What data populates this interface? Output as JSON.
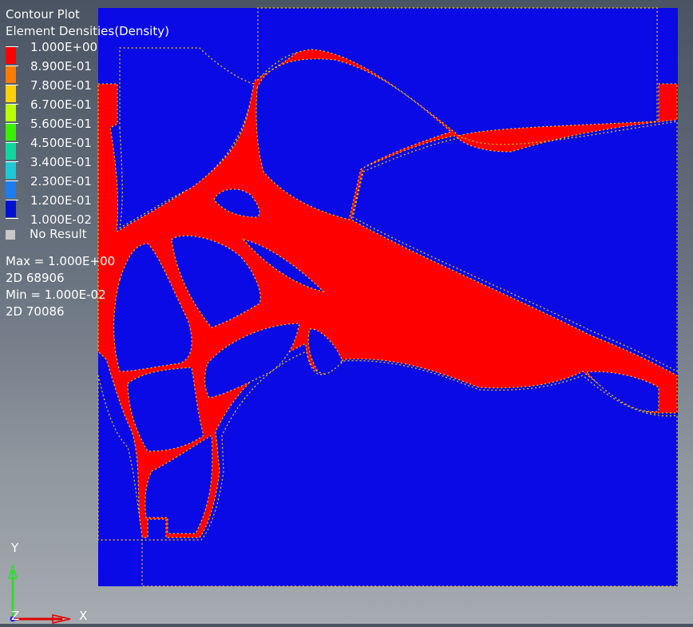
{
  "legend": {
    "title": "Contour Plot",
    "subtitle": "Element Densities(Density)",
    "levels": [
      {
        "label": "1.000E+00",
        "color": "#ff0000"
      },
      {
        "label": "8.900E-01",
        "color": "#ff7b00"
      },
      {
        "label": "7.800E-01",
        "color": "#ffd000"
      },
      {
        "label": "6.700E-01",
        "color": "#b9ff00"
      },
      {
        "label": "5.600E-01",
        "color": "#3bf000"
      },
      {
        "label": "4.500E-01",
        "color": "#11d6a0"
      },
      {
        "label": "3.400E-01",
        "color": "#1ec8d6"
      },
      {
        "label": "2.300E-01",
        "color": "#1a7df0"
      },
      {
        "label": "1.200E-01",
        "color": "#0012d0"
      },
      {
        "label": "1.000E-02",
        "color": null
      }
    ],
    "no_result_label": "No Result"
  },
  "stats": {
    "max": "Max =  1.000E+00",
    "max_element": "2D 68906",
    "min": "Min =  1.000E-02",
    "min_element": "2D 70086"
  },
  "triad": {
    "x_label": "X",
    "y_label": "Y",
    "z_label": "Z"
  },
  "colors": {
    "design_domain": "#0a0ae6",
    "material": "#ff0000"
  }
}
